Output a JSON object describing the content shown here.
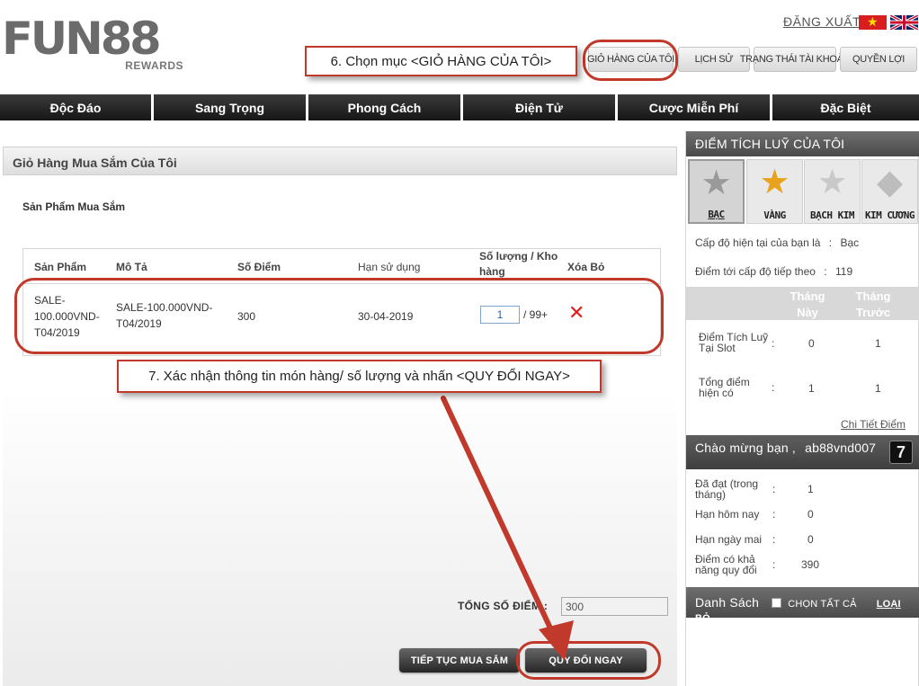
{
  "brand": {
    "logo": "FUN88",
    "logo_sub": "REWARDS"
  },
  "header": {
    "logout": "ĐĂNG XUẤT",
    "flags": [
      "vn-flag-icon",
      "uk-flag-icon"
    ]
  },
  "topnav": [
    {
      "label": "GIỎ HÀNG CỦA TÔI"
    },
    {
      "label": "LỊCH SỬ"
    },
    {
      "label": "TRẠNG THÁI TÀI KHOẢN"
    },
    {
      "label": "QUYỀN LỢI"
    }
  ],
  "mainnav": [
    "Độc Đáo",
    "Sang Trọng",
    "Phong Cách",
    "Điện Tử",
    "Cược Miễn Phí",
    "Đặc Biệt"
  ],
  "cart": {
    "title": "Giỏ Hàng Mua Sắm Của Tôi",
    "section": "Sản Phẩm Mua Sắm",
    "columns": {
      "product": "Sản Phẩm",
      "description": "Mô Tả",
      "points": "Số Điểm",
      "expiry": "Hạn sử dụng",
      "qty": "Số lượng / Kho hàng",
      "delete": "Xóa Bỏ"
    },
    "row": {
      "product": "SALE-100.000VND-T04/2019",
      "description": "SALE-100.000VND-T04/2019",
      "points": "300",
      "expiry": "30-04-2019",
      "qty": "1",
      "stock": "/ 99+",
      "delete_icon": "red-x-icon"
    },
    "total_label": "TỔNG SỐ ĐIỂM :",
    "total_value": "300",
    "continue_button": "TIẾP TỤC MUA SẮM",
    "redeem_button": "QUY ĐỔI NGAY"
  },
  "sidebar": {
    "points_title": "ĐIỂM TÍCH LUỸ CỦA TÔI",
    "tiers": [
      {
        "label": "BẠC",
        "color": "#9a9a9a"
      },
      {
        "label": "VÀNG",
        "color": "#e8a21c"
      },
      {
        "label": "BẠCH KIM",
        "color": "#c9c9c9"
      },
      {
        "label": "KIM CƯƠNG",
        "color": "#bdbdbd"
      }
    ],
    "current_level_label": "Cấp độ hiện tại của bạn là",
    "current_level_value": "Bạc",
    "next_level_label": "Điểm tới cấp độ tiếp theo",
    "next_level_value": "119",
    "col_this_month": "Tháng Này",
    "col_last_month": "Tháng Trước",
    "slot_label": "Điểm Tích Luỹ Tại Slot",
    "slot_this": "0",
    "slot_last": "1",
    "total_label": "Tổng điểm hiện có",
    "total_this": "1",
    "total_last": "1",
    "details_link": "Chi Tiết Điểm",
    "welcome_label": "Chào mừng bạn ,",
    "username": "ab88vnd007",
    "reached_label": "Đã đạt (trong tháng)",
    "reached_value": "1",
    "today_label": "Hạn hôm nay",
    "today_value": "0",
    "tomorrow_label": "Hạn ngày mai",
    "tomorrow_value": "0",
    "redeemable_label": "Điểm có khả năng quy đổi",
    "redeemable_value": "390",
    "list_title": "Danh Sách",
    "select_all": "CHỌN TẤT CẢ",
    "remove": "LOẠI BỎ"
  },
  "annotations": {
    "step6": "6. Chọn mục <GIỎ HÀNG CỦA TÔI>",
    "step7": "7. Xác nhận thông tin món hàng/ số lượng và nhấn <QUY ĐỔI NGAY>",
    "accent": "#c0392b"
  }
}
